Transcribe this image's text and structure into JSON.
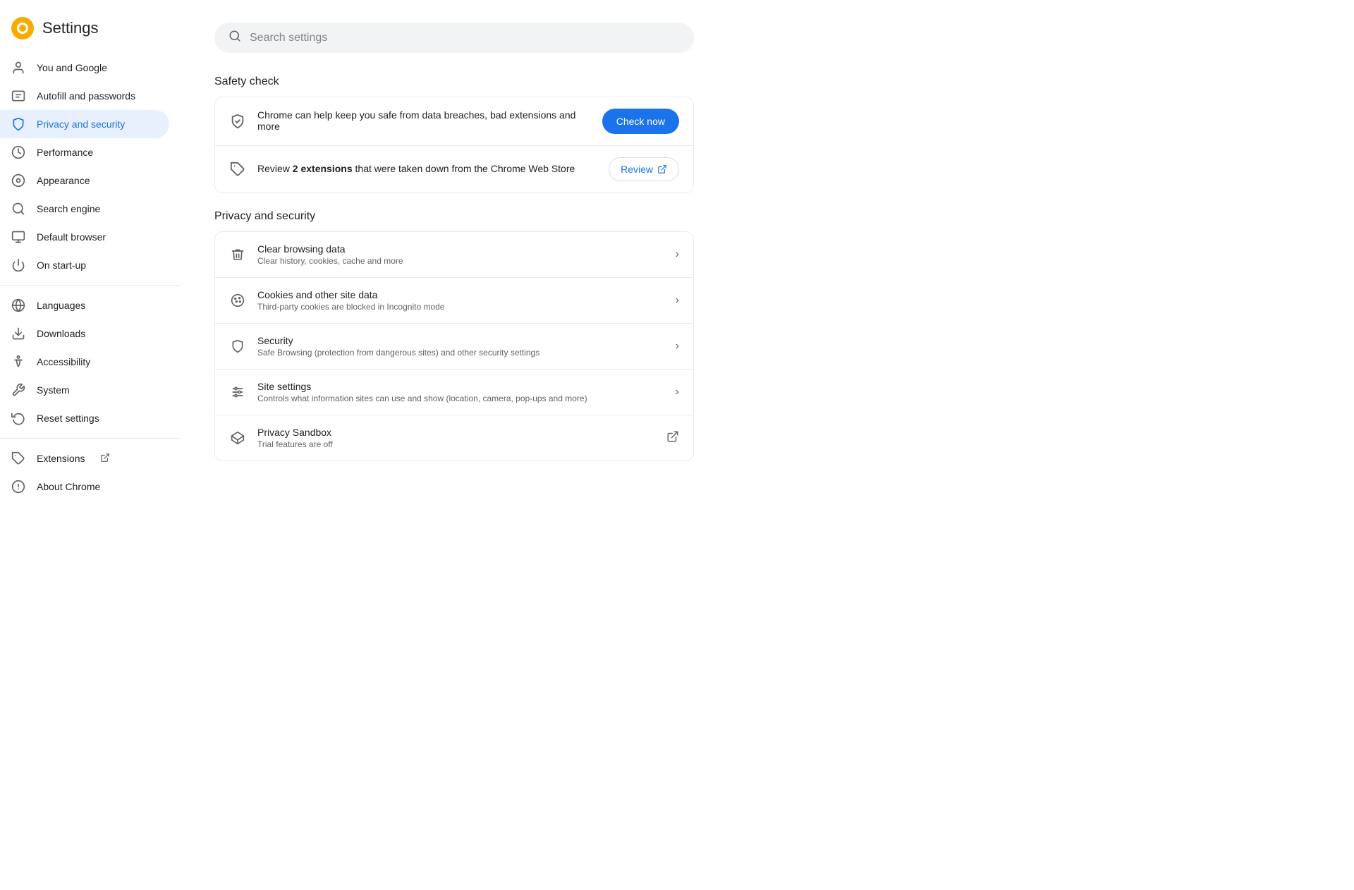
{
  "sidebar": {
    "title": "Settings",
    "logo_color": "#F9AB00",
    "items": [
      {
        "id": "you-and-google",
        "label": "You and Google",
        "icon": "person",
        "active": false
      },
      {
        "id": "autofill-and-passwords",
        "label": "Autofill and passwords",
        "icon": "badge",
        "active": false
      },
      {
        "id": "privacy-and-security",
        "label": "Privacy and security",
        "icon": "shield",
        "active": true
      },
      {
        "id": "performance",
        "label": "Performance",
        "icon": "speed",
        "active": false
      },
      {
        "id": "appearance",
        "label": "Appearance",
        "icon": "palette",
        "active": false
      },
      {
        "id": "search-engine",
        "label": "Search engine",
        "icon": "search",
        "active": false
      },
      {
        "id": "default-browser",
        "label": "Default browser",
        "icon": "monitor",
        "active": false
      },
      {
        "id": "on-startup",
        "label": "On start-up",
        "icon": "power",
        "active": false
      },
      {
        "id": "languages",
        "label": "Languages",
        "icon": "globe",
        "active": false
      },
      {
        "id": "downloads",
        "label": "Downloads",
        "icon": "download",
        "active": false
      },
      {
        "id": "accessibility",
        "label": "Accessibility",
        "icon": "accessibility",
        "active": false
      },
      {
        "id": "system",
        "label": "System",
        "icon": "wrench",
        "active": false
      },
      {
        "id": "reset-settings",
        "label": "Reset settings",
        "icon": "history",
        "active": false
      },
      {
        "id": "extensions",
        "label": "Extensions",
        "icon": "puzzle",
        "active": false,
        "external": true
      },
      {
        "id": "about-chrome",
        "label": "About Chrome",
        "icon": "info",
        "active": false
      }
    ]
  },
  "search": {
    "placeholder": "Search settings"
  },
  "safety_check": {
    "section_title": "Safety check",
    "rows": [
      {
        "id": "check-now",
        "icon": "shield-check",
        "title": "Chrome can help keep you safe from data breaches, bad extensions and more",
        "subtitle": "",
        "action_type": "button",
        "action_label": "Check now"
      },
      {
        "id": "review-extensions",
        "icon": "puzzle",
        "title_before": "Review ",
        "title_bold": "2 extensions",
        "title_after": " that were taken down from the Chrome Web Store",
        "subtitle": "",
        "action_type": "review_button",
        "action_label": "Review"
      }
    ]
  },
  "privacy_security": {
    "section_title": "Privacy and security",
    "rows": [
      {
        "id": "clear-browsing-data",
        "icon": "trash",
        "title": "Clear browsing data",
        "subtitle": "Clear history, cookies, cache and more",
        "action_type": "chevron"
      },
      {
        "id": "cookies",
        "icon": "cookie",
        "title": "Cookies and other site data",
        "subtitle": "Third-party cookies are blocked in Incognito mode",
        "action_type": "chevron"
      },
      {
        "id": "security",
        "icon": "shield",
        "title": "Security",
        "subtitle": "Safe Browsing (protection from dangerous sites) and other security settings",
        "action_type": "chevron"
      },
      {
        "id": "site-settings",
        "icon": "sliders",
        "title": "Site settings",
        "subtitle": "Controls what information sites can use and show (location, camera, pop-ups and more)",
        "action_type": "chevron"
      },
      {
        "id": "privacy-sandbox",
        "icon": "sandbox",
        "title": "Privacy Sandbox",
        "subtitle": "Trial features are off",
        "action_type": "external"
      }
    ]
  }
}
